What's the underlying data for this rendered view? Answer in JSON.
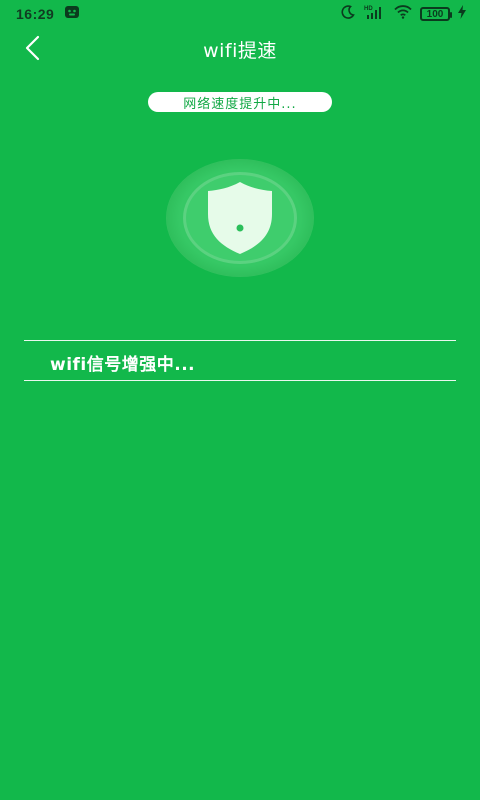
{
  "status_bar": {
    "time": "16:29",
    "battery": "100",
    "icons": [
      "notification-app-icon",
      "moon-icon",
      "signal-icon",
      "wifi-icon",
      "battery-icon",
      "charging-icon"
    ]
  },
  "nav": {
    "title": "wifi提速",
    "back_icon": "chevron-left-icon"
  },
  "progress": {
    "label": "网络速度提升中..."
  },
  "shield": {
    "icon": "shield-icon"
  },
  "status_line": {
    "label": "wifi信号增强中..."
  },
  "colors": {
    "background": "#12b84b",
    "pill_text": "#12a845",
    "shield_fill": "#e6fbe9",
    "shield_dot": "#2bbf5a"
  }
}
